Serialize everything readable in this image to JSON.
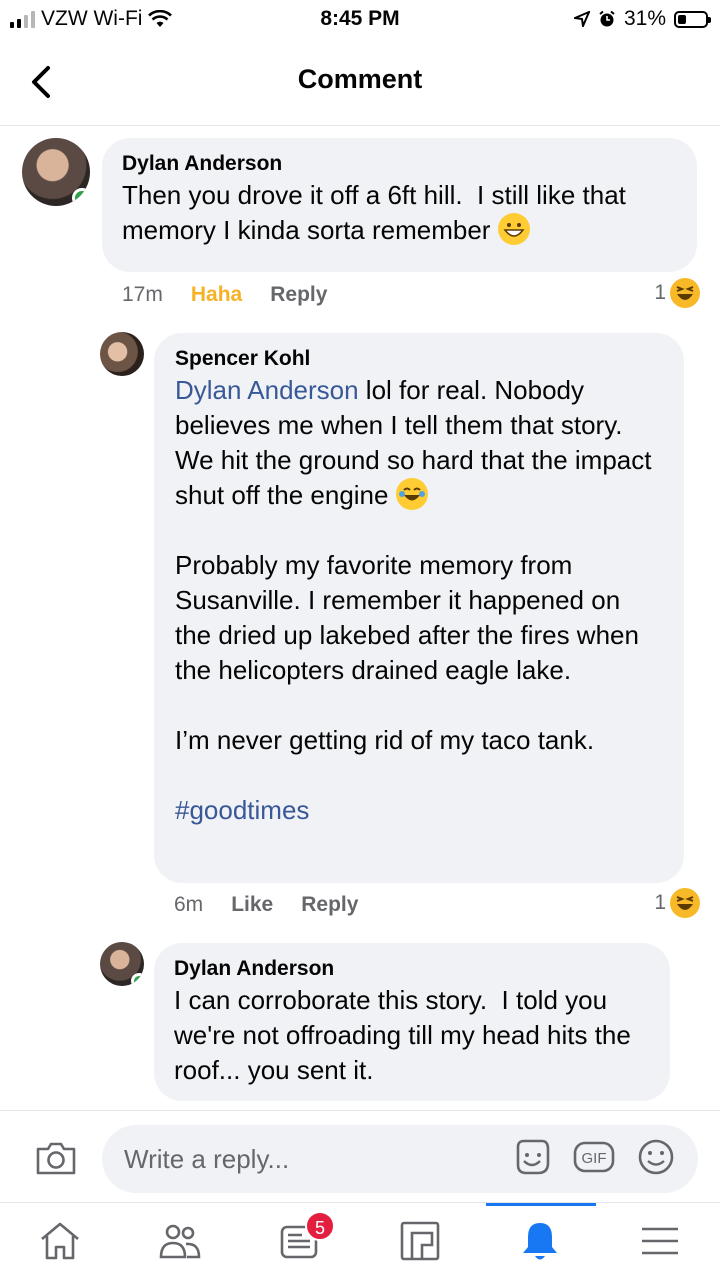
{
  "status_bar": {
    "carrier": "VZW Wi-Fi",
    "time": "8:45 PM",
    "battery_percent": "31%",
    "battery_level": 0.31
  },
  "header": {
    "title": "Comment"
  },
  "comments": [
    {
      "author": "Dylan Anderson",
      "text": "Then you drove it off a 6ft hill.  I still like that memory I kinda sorta remember",
      "timestamp": "17m",
      "action_reaction": "Haha",
      "action_reply": "Reply",
      "reaction_count": "1",
      "online": true
    },
    {
      "author": "Spencer Kohl",
      "mention": "Dylan Anderson",
      "text_1": " lol for real. Nobody believes me when I tell them that story. We hit the ground so hard that the impact shut off the engine",
      "text_2": "Probably my favorite memory from Susanville. I remember it happened on the dried up lakebed after the fires when the helicopters drained eagle lake.",
      "text_3": "I’m never getting rid of my taco tank.",
      "hashtag": "#goodtimes",
      "timestamp": "6m",
      "action_reaction": "Like",
      "action_reply": "Reply",
      "reaction_count": "1"
    },
    {
      "author": "Dylan Anderson",
      "text": "I can corroborate this story.  I told you we're not offroading till my head hits the roof... you sent it.",
      "online": true
    }
  ],
  "composer": {
    "placeholder": "Write a reply...",
    "gif_label": "GIF"
  },
  "tabbar": {
    "notifications_badge": "5"
  },
  "colors": {
    "accent": "#1877f2",
    "haha": "#f7b125",
    "mention": "#385898",
    "bubble": "#f0f2f5"
  }
}
